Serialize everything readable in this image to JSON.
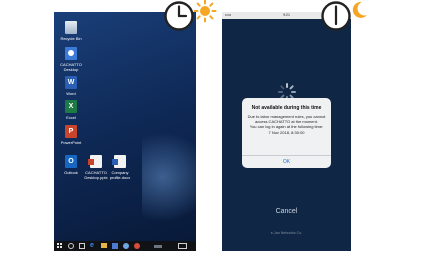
{
  "desktop": {
    "icons": [
      {
        "label": "Recycle Bin",
        "icon": "recycle-bin-icon"
      },
      {
        "label": "CACHATTO Desktop",
        "icon": "cachatto-icon"
      },
      {
        "label": "Word",
        "icon": "word-icon"
      },
      {
        "label": "Excel",
        "icon": "excel-icon"
      },
      {
        "label": "PowerPoint",
        "icon": "powerpoint-icon"
      },
      {
        "label": "Outlook",
        "icon": "outlook-icon"
      },
      {
        "label": "CACHATTO Desktop.pptx",
        "icon": "pptx-file-icon"
      },
      {
        "label": "Company profile.docx",
        "icon": "docx-file-icon"
      }
    ],
    "taskbar": [
      "start-icon",
      "search-icon",
      "task-view-icon",
      "edge-icon",
      "folder-icon",
      "store-icon",
      "app-icon",
      "chrome-icon"
    ]
  },
  "phone": {
    "status": {
      "carrier": "••••• ",
      "time": "9:21"
    },
    "dialog": {
      "title": "Not available during this time",
      "message": "Due to labor management rules, you cannot access CACHATTO at the moment.",
      "message2": "You can log in again at the following time:",
      "datetime": "7 Nov 2018, 8:30:00",
      "ok_label": "OK"
    },
    "cancel_label": "Cancel",
    "company": "e-Jan Networks Co."
  },
  "indicators": {
    "daytime": "sun-icon",
    "nighttime": "moon-icon",
    "sun_color": "#f5a623",
    "moon_color": "#f5a623"
  }
}
